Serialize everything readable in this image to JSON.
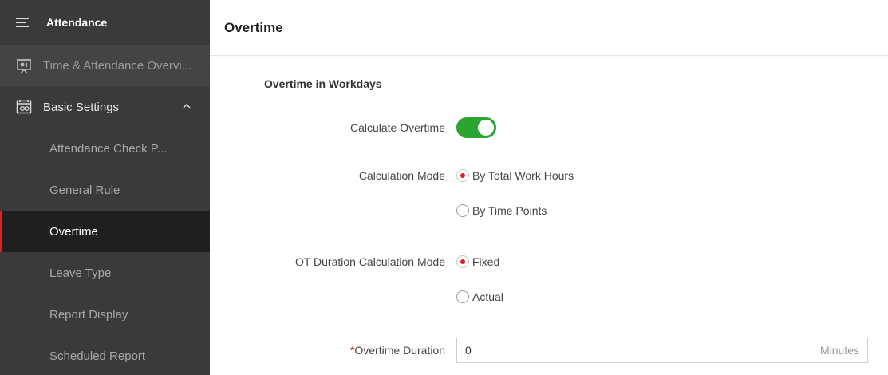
{
  "sidebar": {
    "header": "Attendance",
    "overview": "Time & Attendance Overvi...",
    "group": "Basic Settings",
    "items": [
      {
        "label": "Attendance Check P..."
      },
      {
        "label": "General Rule"
      },
      {
        "label": "Overtime",
        "active": true
      },
      {
        "label": "Leave Type"
      },
      {
        "label": "Report Display"
      },
      {
        "label": "Scheduled Report"
      }
    ]
  },
  "page": {
    "title": "Overtime",
    "section": "Overtime in Workdays",
    "calculate_overtime": {
      "label": "Calculate Overtime",
      "enabled": true
    },
    "calculation_mode": {
      "label": "Calculation Mode",
      "options": [
        "By Total Work Hours",
        "By Time Points"
      ],
      "selected": "By Total Work Hours"
    },
    "ot_duration_mode": {
      "label": "OT Duration Calculation Mode",
      "options": [
        "Fixed",
        "Actual"
      ],
      "selected": "Fixed"
    },
    "overtime_duration": {
      "required_mark": "*",
      "label": "Overtime Duration",
      "value": "0",
      "unit": "Minutes"
    }
  },
  "colors": {
    "accent": "#e02020",
    "toggle_on": "#2aa530",
    "sidebar_bg": "#3a3a3a",
    "sidebar_active": "#1f1f1f"
  }
}
